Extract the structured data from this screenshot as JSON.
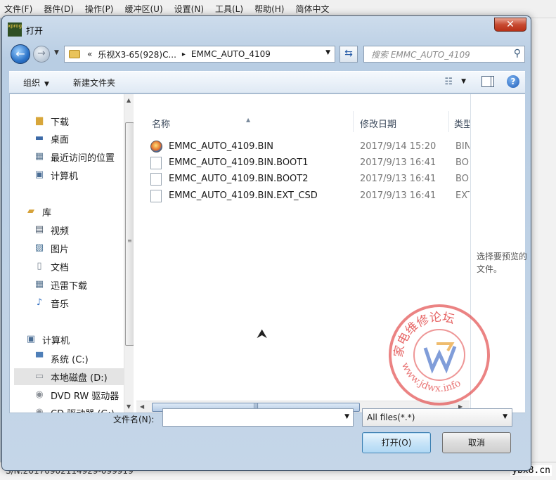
{
  "app_menu": [
    "文件(F)",
    "器件(D)",
    "操作(P)",
    "缓冲区(U)",
    "设置(N)",
    "工具(L)",
    "帮助(H)",
    "简体中文"
  ],
  "app_status": "S/N:20170902114929-099919",
  "watermark_footer": "ybx8.cn",
  "dialog": {
    "app_icon": "xprog",
    "title": "打开",
    "close": "✕",
    "address": {
      "prefix": "«",
      "segment1": "乐视X3-65(928)C...",
      "separator": "▸",
      "segment2": "EMMC_AUTO_4109"
    },
    "search_placeholder": "搜索 EMMC_AUTO_4109",
    "toolbar": {
      "organize": "组织",
      "new_folder": "新建文件夹"
    },
    "nav": {
      "downloads": "下载",
      "desktop": "桌面",
      "recent": "最近访问的位置",
      "computer_fav": "计算机",
      "library": "库",
      "videos": "视频",
      "pictures": "图片",
      "documents": "文档",
      "thunder": "迅雷下载",
      "music": "音乐",
      "computer": "计算机",
      "drive_c": "系统 (C:)",
      "drive_d": "本地磁盘 (D:)",
      "dvd": "DVD RW 驱动器",
      "cd": "CD 驱动器 (G:)"
    },
    "columns": {
      "name": "名称",
      "date": "修改日期",
      "type": "类型"
    },
    "files": [
      {
        "name": "EMMC_AUTO_4109.BIN",
        "date": "2017/9/14 15:20",
        "type": "BIN"
      },
      {
        "name": "EMMC_AUTO_4109.BIN.BOOT1",
        "date": "2017/9/13 16:41",
        "type": "BO"
      },
      {
        "name": "EMMC_AUTO_4109.BIN.BOOT2",
        "date": "2017/9/13 16:41",
        "type": "BO"
      },
      {
        "name": "EMMC_AUTO_4109.BIN.EXT_CSD",
        "date": "2017/9/13 16:41",
        "type": "EXT"
      }
    ],
    "preview_text": "选择要预览的文件。",
    "filename_label": "文件名(N):",
    "filename_value": "",
    "file_type": "All files(*.*)",
    "open_button": "打开(O)",
    "cancel_button": "取消"
  },
  "site_watermark": {
    "top_text": "家电维修论坛",
    "url": "www.jdwx.info"
  },
  "colors": {
    "accent": "#1e5bb7",
    "watermark_red": "#e04040",
    "selection": "#e4e4e4"
  }
}
